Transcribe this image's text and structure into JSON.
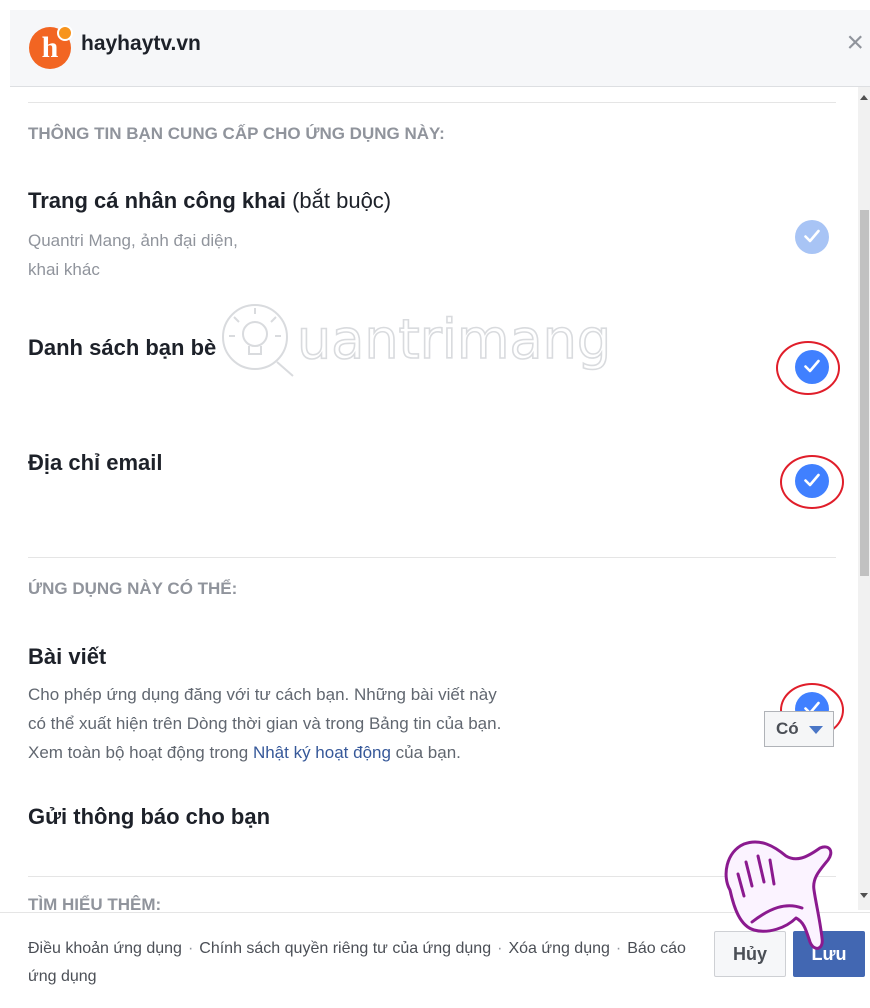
{
  "header": {
    "logo_letter": "h",
    "app_name": "hayhaytv.vn",
    "close_icon": "close-icon"
  },
  "sections": {
    "provided_title": "THÔNG TIN BẠN CUNG CẤP CHO ỨNG DỤNG NÀY:",
    "can_do_title": "ỨNG DỤNG NÀY CÓ THỂ:",
    "learn_more_title": "TÌM HIỂU THÊM:"
  },
  "permissions": {
    "public_profile": {
      "title": "Trang cá nhân công khai",
      "suffix": "(bắt buộc)",
      "desc_line1": "Quantri Mang, ảnh đại diện,",
      "desc_line2": "khai khác",
      "checked": true
    },
    "friends": {
      "title": "Danh sách bạn bè",
      "checked": true
    },
    "email": {
      "title": "Địa chỉ email",
      "checked": true
    },
    "posts": {
      "title": "Bài viết",
      "desc_line1": "Cho phép ứng dụng đăng với tư cách bạn. Những bài viết này",
      "desc_line2": "có thể xuất hiện trên Dòng thời gian và trong Bảng tin của bạn.",
      "desc_line3_before": "Xem toàn bộ hoạt động trong ",
      "desc_line3_link": "Nhật ký hoạt động",
      "desc_line3_after": " của bạn.",
      "checked": true
    },
    "notifications": {
      "title": "Gửi thông báo cho bạn",
      "dropdown_value": "Có"
    }
  },
  "footer": {
    "link1": "Điều khoản ứng dụng",
    "link2": "Chính sách quyền riêng tư của ứng dụng",
    "link3": "Xóa ứng dụng",
    "link4": "Báo cáo ứng dụng",
    "separator": "·",
    "cancel_label": "Hủy",
    "save_label": "Lưu"
  },
  "watermark": {
    "text": "uantrimang"
  },
  "colors": {
    "accent": "#4267b2",
    "check_blue": "#4080ff",
    "link": "#365899",
    "logo": "#f26522",
    "annotation_red": "#e01e2a"
  }
}
